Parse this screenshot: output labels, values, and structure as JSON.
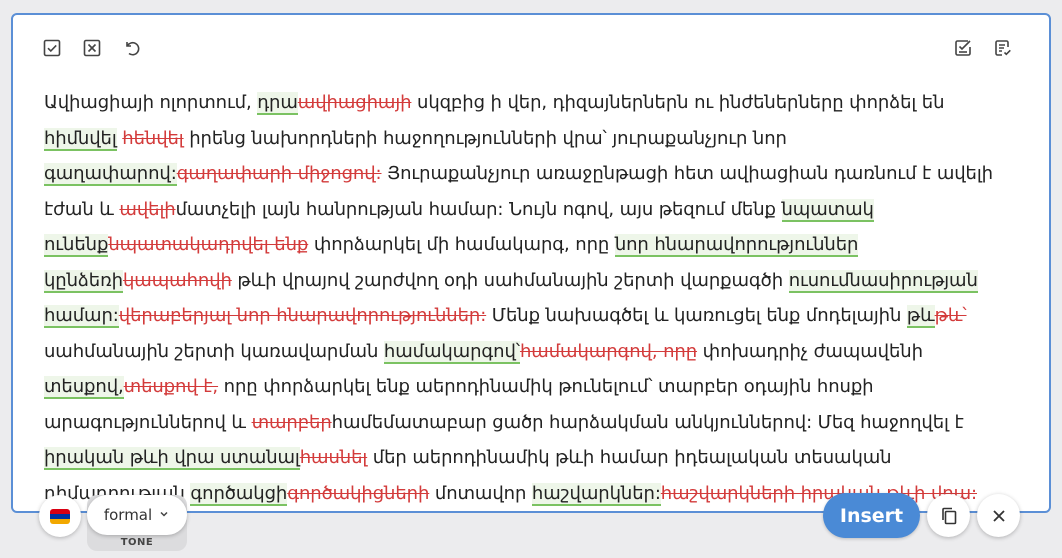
{
  "toolbar": {
    "left_icons": [
      "accept-all-icon",
      "reject-all-icon",
      "undo-icon"
    ],
    "right_icons": [
      "checklist-icon",
      "notes-icon"
    ]
  },
  "content": {
    "segments": [
      {
        "t": "Ավիացիայի ոլորտում, ",
        "k": "n"
      },
      {
        "t": "դրա",
        "k": "i"
      },
      {
        "t": "ավիացիայի",
        "k": "d"
      },
      {
        "t": " սկզբից ի վեր, դիզայներներն ու ինժեներները փորձել են ",
        "k": "n"
      },
      {
        "t": "հիմնվել",
        "k": "i"
      },
      {
        "t": " ",
        "k": "n"
      },
      {
        "t": "հենվել",
        "k": "d"
      },
      {
        "t": " իրենց նախորդների հաջողությունների վրա՝ յուրաքանչյուր նոր ",
        "k": "n"
      },
      {
        "t": "գաղափարով:",
        "k": "i"
      },
      {
        "t": "գաղափարի միջոցով:",
        "k": "d"
      },
      {
        "t": " Յուրաքանչյուր առաջընթացի հետ ավիացիան դառնում է ավելի էժան և ",
        "k": "n"
      },
      {
        "t": "ավելի",
        "k": "d"
      },
      {
        "t": "մատչելի լայն հանրության համար: Նույն ոգով, այս թեզում մենք ",
        "k": "n"
      },
      {
        "t": "նպատակ ունենք",
        "k": "i"
      },
      {
        "t": "նպատակադրվել ենք",
        "k": "d"
      },
      {
        "t": " փորձարկել մի համակարգ, որը ",
        "k": "n"
      },
      {
        "t": "նոր հնարավորություններ կընձեռի",
        "k": "i"
      },
      {
        "t": "կապահովի",
        "k": "d"
      },
      {
        "t": " թևի վրայով շարժվող օդի սահմանային շերտի վարքագծի ",
        "k": "n"
      },
      {
        "t": "ուսումնասիրության համար:",
        "k": "i"
      },
      {
        "t": "վերաբերյալ նոր հնարավորություններ:",
        "k": "d"
      },
      {
        "t": " Մենք նախագծել և կառուցել ենք մոդելային ",
        "k": "n"
      },
      {
        "t": "թև",
        "k": "i"
      },
      {
        "t": "թև՝",
        "k": "d"
      },
      {
        "t": " սահմանային շերտի կառավարման ",
        "k": "n"
      },
      {
        "t": "համակարգով՝",
        "k": "i"
      },
      {
        "t": "համակարգով, որը",
        "k": "d"
      },
      {
        "t": " փոխադրիչ ժապավենի ",
        "k": "n"
      },
      {
        "t": "տեսքով,",
        "k": "i"
      },
      {
        "t": "տեսքով է,",
        "k": "d"
      },
      {
        "t": " որը փորձարկել ենք աերոդինամիկ թունելում՝ տարբեր օդային հոսքի արագություններով և ",
        "k": "n"
      },
      {
        "t": "տարբեր",
        "k": "d"
      },
      {
        "t": "համեմատաբար ցածր հարձակման անկյուններով: Մեզ հաջողվել է ",
        "k": "n"
      },
      {
        "t": "իրական թևի վրա ստանալ",
        "k": "i"
      },
      {
        "t": "հասնել",
        "k": "d"
      },
      {
        "t": " մեր աերոդինամիկ թևի համար իդեալական տեսական դիմադրության ",
        "k": "n"
      },
      {
        "t": "գործակցի",
        "k": "i"
      },
      {
        "t": "գործակիցների",
        "k": "d"
      },
      {
        "t": " մոտավոր ",
        "k": "n"
      },
      {
        "t": "հաշվարկներ:",
        "k": "i"
      },
      {
        "t": "հաշվարկների իրական թևի վրա:",
        "k": "d"
      }
    ]
  },
  "language": {
    "flag_colors": [
      "#d90012",
      "#0033a0",
      "#f2a800"
    ],
    "icon": "armenia-flag-icon"
  },
  "tone": {
    "value": "formal",
    "label": "TONE"
  },
  "actions": {
    "insert_label": "Insert",
    "copy_icon": "copy-icon",
    "close_icon": "close-icon"
  },
  "colors": {
    "accent": "#4a8ad6",
    "insert_bg": "#eef6e9",
    "insert_underline": "#7bc262",
    "delete": "#d33b3b"
  }
}
